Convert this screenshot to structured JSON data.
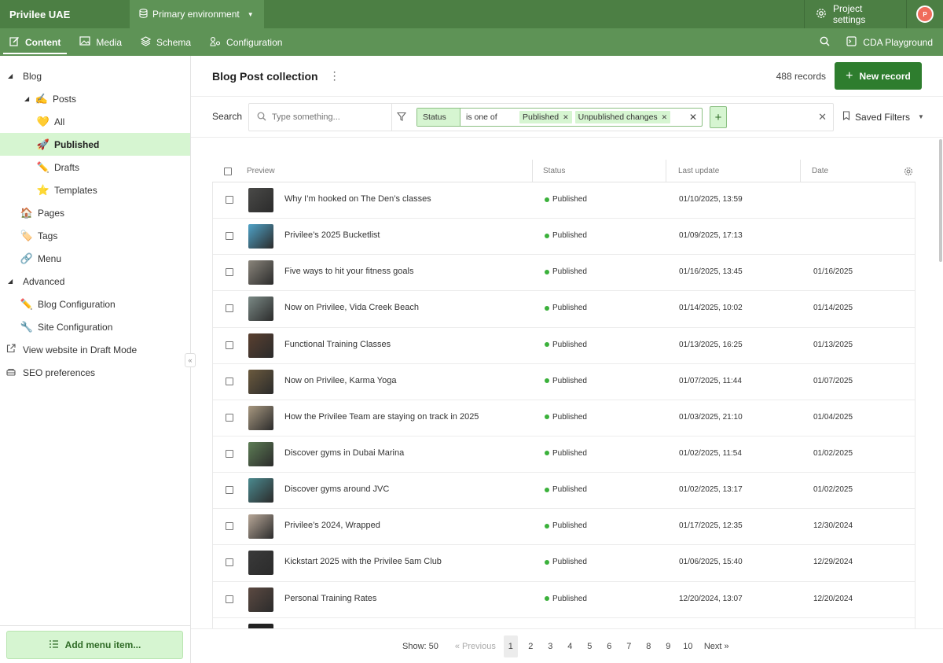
{
  "topbar": {
    "project_name": "Privilee UAE",
    "environment": "Primary environment",
    "project_settings": "Project settings",
    "avatar_initial": "P"
  },
  "nav": {
    "tabs": [
      {
        "label": "Content",
        "icon": "edit-icon"
      },
      {
        "label": "Media",
        "icon": "image-icon"
      },
      {
        "label": "Schema",
        "icon": "layers-icon"
      },
      {
        "label": "Configuration",
        "icon": "config-icon"
      }
    ],
    "active_tab": "Content",
    "cda_playground": "CDA Playground"
  },
  "sidebar": {
    "items": [
      {
        "label": "Blog",
        "icon": "caret-down-icon"
      },
      {
        "label": "Posts",
        "emoji": "✍️"
      },
      {
        "label": "All",
        "emoji": "💛"
      },
      {
        "label": "Published",
        "emoji": "🚀"
      },
      {
        "label": "Drafts",
        "emoji": "✏️"
      },
      {
        "label": "Templates",
        "emoji": "⭐"
      },
      {
        "label": "Pages",
        "emoji": "🏠"
      },
      {
        "label": "Tags",
        "emoji": "🏷️"
      },
      {
        "label": "Menu",
        "emoji": "🔗"
      },
      {
        "label": "Advanced",
        "icon": "caret-down-icon"
      },
      {
        "label": "Blog Configuration",
        "emoji": "✏️"
      },
      {
        "label": "Site Configuration",
        "emoji": "🔧"
      },
      {
        "label": "View website in Draft Mode",
        "icon": "external-link-icon"
      },
      {
        "label": "SEO preferences",
        "icon": "seo-icon"
      }
    ],
    "active_item": "Published",
    "add_menu_item": "Add menu item..."
  },
  "main": {
    "title": "Blog Post collection",
    "record_count": "488 records",
    "new_record": "New record"
  },
  "filters": {
    "search_label": "Search",
    "search_placeholder": "Type something...",
    "condition_field": "Status",
    "condition_operator": "is one of",
    "condition_values": [
      "Published",
      "Unpublished changes"
    ],
    "saved_filters": "Saved Filters"
  },
  "table": {
    "columns": [
      "Preview",
      "Status",
      "Last update",
      "Date"
    ],
    "rows": [
      {
        "title": "Why I’m hooked on The Den’s classes",
        "status": "Published",
        "last_update": "01/10/2025, 13:59",
        "date": "",
        "thumb": "#4a4a48"
      },
      {
        "title": "Privilee’s 2025 Bucketlist",
        "status": "Published",
        "last_update": "01/09/2025, 17:13",
        "date": "",
        "thumb": "#4fa3c8"
      },
      {
        "title": "Five ways to hit your fitness goals",
        "status": "Published",
        "last_update": "01/16/2025, 13:45",
        "date": "01/16/2025",
        "thumb": "#8a857b"
      },
      {
        "title": "Now on Privilee, Vida Creek Beach",
        "status": "Published",
        "last_update": "01/14/2025, 10:02",
        "date": "01/14/2025",
        "thumb": "#7b8a86"
      },
      {
        "title": "Functional Training Classes",
        "status": "Published",
        "last_update": "01/13/2025, 16:25",
        "date": "01/13/2025",
        "thumb": "#5a4030"
      },
      {
        "title": "Now on Privilee, Karma Yoga",
        "status": "Published",
        "last_update": "01/07/2025, 11:44",
        "date": "01/07/2025",
        "thumb": "#6b5a3e"
      },
      {
        "title": "How the Privilee Team are staying on track in 2025",
        "status": "Published",
        "last_update": "01/03/2025, 21:10",
        "date": "01/04/2025",
        "thumb": "#a89880"
      },
      {
        "title": "Discover gyms in Dubai Marina",
        "status": "Published",
        "last_update": "01/02/2025, 11:54",
        "date": "01/02/2025",
        "thumb": "#5d7d55"
      },
      {
        "title": "Discover gyms around JVC",
        "status": "Published",
        "last_update": "01/02/2025, 13:17",
        "date": "01/02/2025",
        "thumb": "#4b8a8f"
      },
      {
        "title": "Privilee’s 2024, Wrapped",
        "status": "Published",
        "last_update": "01/17/2025, 12:35",
        "date": "12/30/2024",
        "thumb": "#b8a898"
      },
      {
        "title": "Kickstart 2025 with the Privilee 5am Club",
        "status": "Published",
        "last_update": "01/06/2025, 15:40",
        "date": "12/29/2024",
        "thumb": "#3a3a3a"
      },
      {
        "title": "Personal Training Rates",
        "status": "Published",
        "last_update": "12/20/2024, 13:07",
        "date": "12/20/2024",
        "thumb": "#5c4a42"
      }
    ],
    "status_color": "#3bb13b"
  },
  "pagination": {
    "show": "Show: 50",
    "previous": "« Previous",
    "pages": [
      "1",
      "2",
      "3",
      "4",
      "5",
      "6",
      "7",
      "8",
      "9",
      "10"
    ],
    "current_page": "1",
    "next": "Next »"
  },
  "colors": {
    "topbar": "#4c7f44",
    "navbar": "#5e9356",
    "accent": "#2e7d2e",
    "highlight": "#d6f5d1"
  }
}
